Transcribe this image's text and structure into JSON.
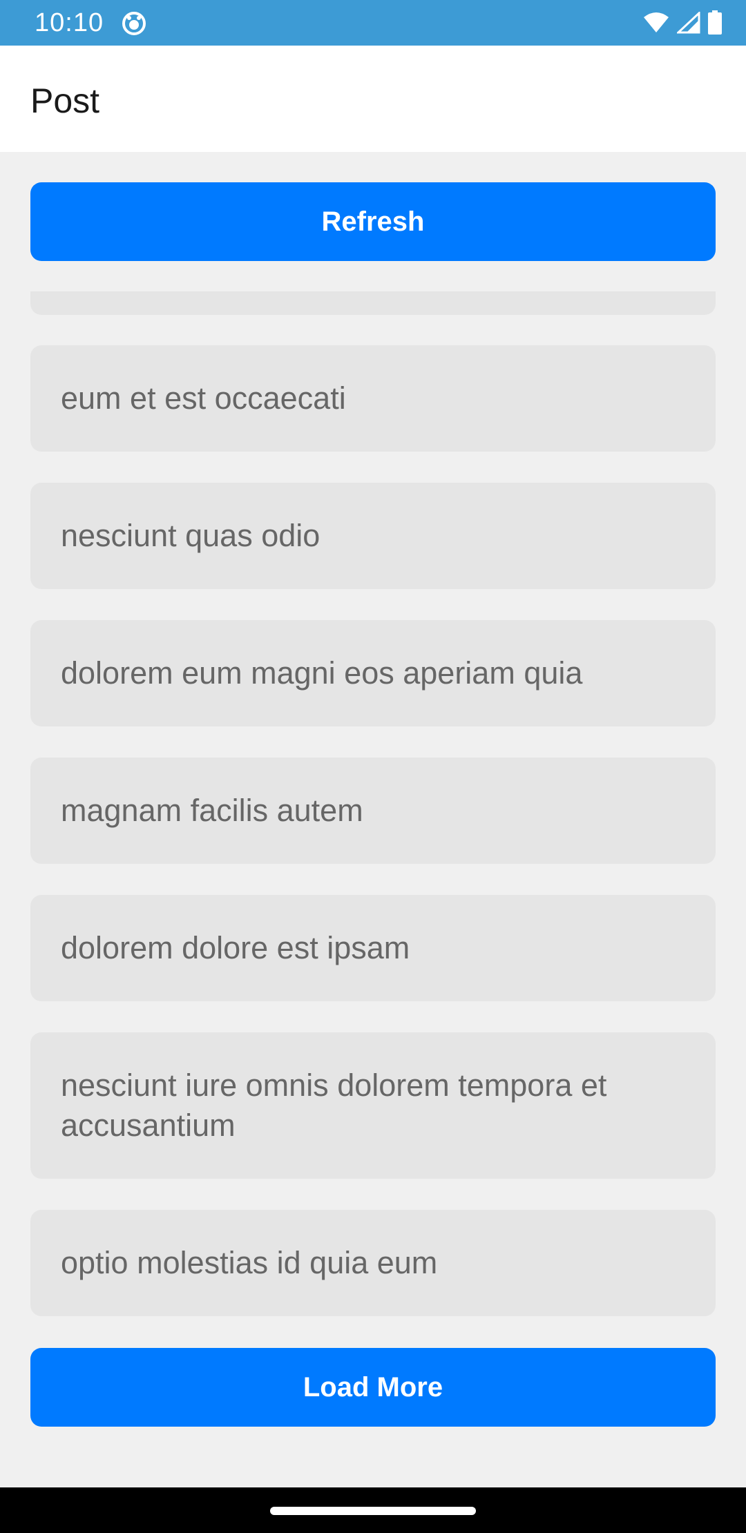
{
  "status_bar": {
    "time": "10:10",
    "icons": [
      "app-notification-icon",
      "wifi-icon",
      "cellular-signal-icon",
      "battery-icon"
    ],
    "background_color": "#3d9bd5"
  },
  "app_bar": {
    "title": "Post"
  },
  "actions": {
    "refresh_label": "Refresh",
    "load_more_label": "Load More",
    "button_color": "#007aff"
  },
  "posts": [
    {
      "title": ""
    },
    {
      "title": "eum et est occaecati"
    },
    {
      "title": "nesciunt quas odio"
    },
    {
      "title": "dolorem eum magni eos aperiam quia"
    },
    {
      "title": "magnam facilis autem"
    },
    {
      "title": "dolorem dolore est ipsam"
    },
    {
      "title": "nesciunt iure omnis dolorem tempora et accusantium"
    },
    {
      "title": "optio molestias id quia eum"
    }
  ]
}
